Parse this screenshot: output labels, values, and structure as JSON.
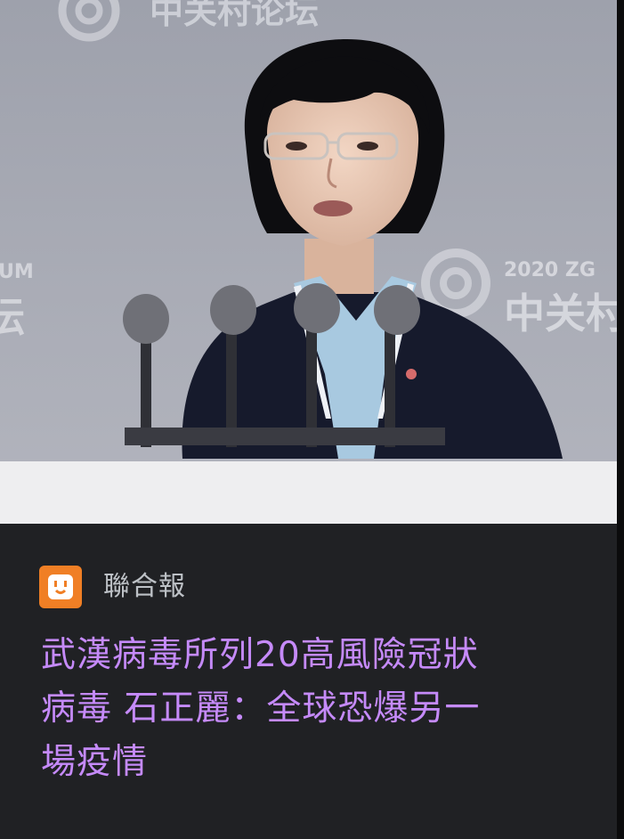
{
  "article": {
    "image_alt": "A woman with short black hair and glasses speaking at a podium with four microphones in front of a gray conference backdrop",
    "backdrop": {
      "forum_name_top": "中关村论坛",
      "year_label": "2020 ZG",
      "forum_name_right": "中关村",
      "left_partial_latin": "UM",
      "left_partial_char": "坛"
    },
    "source": {
      "name": "聯合報",
      "logo_icon": "power-outlet-icon",
      "logo_color": "#f07f25"
    },
    "headline_lines": {
      "line1": "武漢病毒所列20高風險冠狀",
      "line2": "病毒 石正麗：全球恐爆另一",
      "line3": "場疫情"
    },
    "colors": {
      "card_background": "#202124",
      "headline": "#c58af9",
      "source_text": "#bdc1c6"
    }
  }
}
